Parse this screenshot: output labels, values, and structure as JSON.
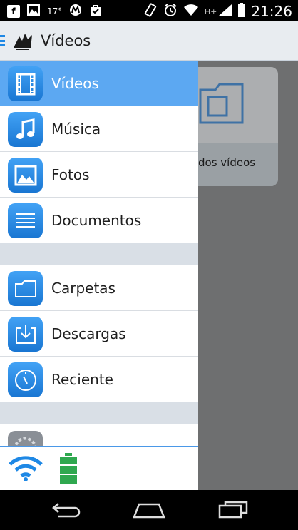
{
  "status_bar": {
    "temperature": "17°",
    "time": "21:26",
    "network_type": "H+",
    "icons": [
      "facebook-icon",
      "image-icon",
      "motorola-icon",
      "bag-icon",
      "rotation-icon",
      "alarm-icon",
      "wifi-icon",
      "signal-icon",
      "battery-icon"
    ]
  },
  "header": {
    "title": "Vídeos",
    "menu_icon": "hamburger-icon",
    "logo_icon": "bird-logo-icon"
  },
  "background_card": {
    "label": "dos vídeos",
    "icon": "video-folder-icon"
  },
  "drawer": {
    "items": [
      {
        "label": "Vídeos",
        "icon": "film-icon",
        "active": true
      },
      {
        "label": "Música",
        "icon": "music-note-icon"
      },
      {
        "label": "Fotos",
        "icon": "photo-icon"
      },
      {
        "label": "Documentos",
        "icon": "document-icon"
      },
      {
        "label": "Carpetas",
        "icon": "folder-icon"
      },
      {
        "label": "Descargas",
        "icon": "download-tray-icon"
      },
      {
        "label": "Reciente",
        "icon": "clock-icon"
      }
    ],
    "footer_icons": [
      "wifi-icon",
      "battery-level-icon"
    ]
  },
  "colors": {
    "accent": "#1e88e5",
    "active_row": "#5ca8f2",
    "separator": "#d9dfe6",
    "battery": "#2fa84f"
  },
  "nav_bar": {
    "icons": [
      "back-icon",
      "home-icon",
      "recent-apps-icon"
    ]
  }
}
